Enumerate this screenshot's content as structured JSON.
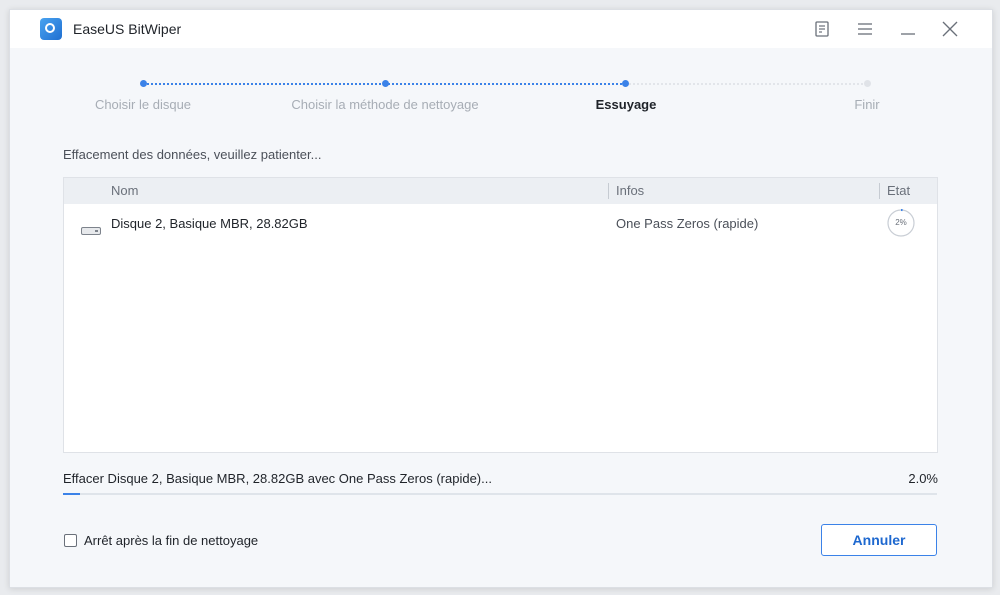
{
  "window": {
    "title": "EaseUS BitWiper",
    "logo_icon": "easeus-bitwiper-logo"
  },
  "titlebar_buttons": [
    {
      "name": "feedback-icon"
    },
    {
      "name": "menu-icon"
    },
    {
      "name": "minimize-icon"
    },
    {
      "name": "close-icon"
    }
  ],
  "steps": [
    {
      "label": "Choisir le disque",
      "state": "done"
    },
    {
      "label": "Choisir la méthode de nettoyage",
      "state": "done"
    },
    {
      "label": "Essuyage",
      "state": "active"
    },
    {
      "label": "Finir",
      "state": "pending"
    }
  ],
  "status_text": "Effacement des données, veuillez patienter...",
  "table": {
    "columns": [
      "Nom",
      "Infos",
      "Etat"
    ],
    "rows": [
      {
        "icon": "disk-drive-icon",
        "name": "Disque 2, Basique MBR, 28.82GB",
        "info": "One Pass Zeros (rapide)",
        "progress_label": "2%",
        "progress": 0.02
      }
    ]
  },
  "progress": {
    "text": "Effacer Disque 2, Basique MBR, 28.82GB avec One Pass Zeros (rapide)...",
    "percent_label": "2.0%",
    "fraction": 0.02
  },
  "options": {
    "stop_after_label": "Arrêt après la fin de nettoyage",
    "stop_after_checked": false
  },
  "actions": {
    "cancel_label": "Annuler"
  },
  "colors": {
    "accent": "#3b82e8",
    "pending": "#e0e3e8"
  }
}
